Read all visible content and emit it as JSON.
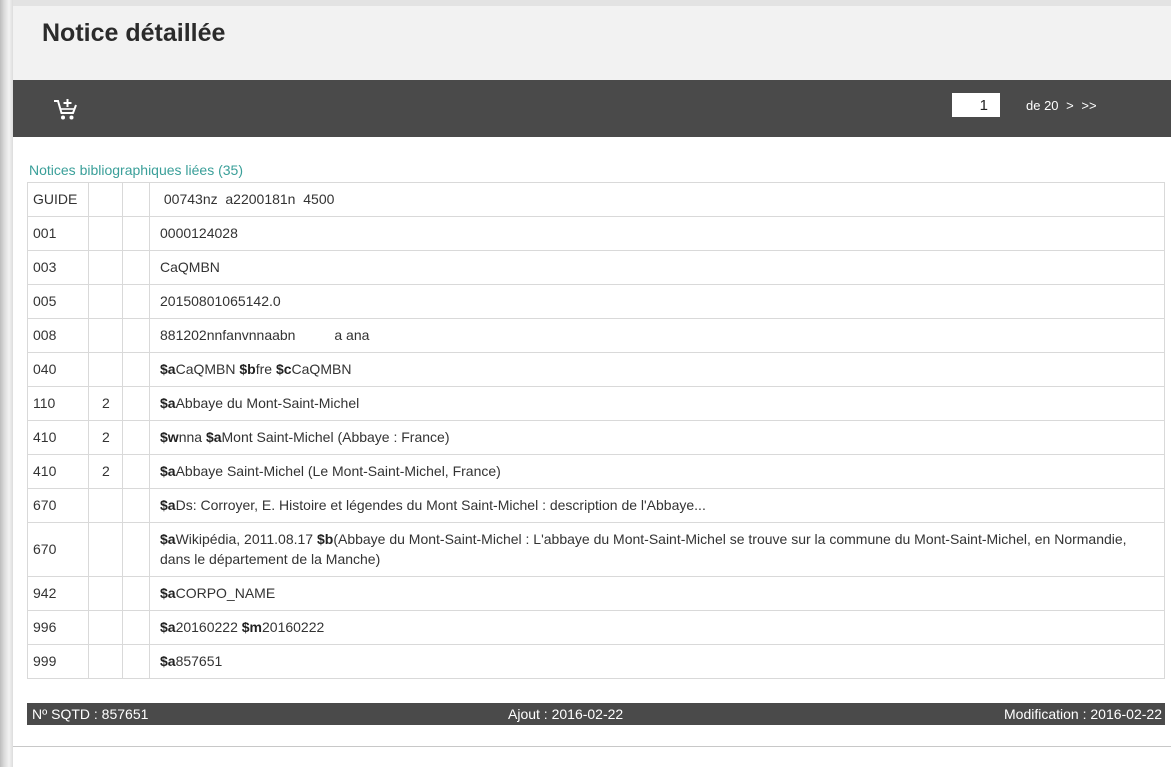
{
  "page": {
    "title": "Notice détaillée"
  },
  "toolbar": {
    "cart_icon": "add-to-cart-icon",
    "current_page": "1",
    "total_label": "de 20",
    "next_label": ">",
    "last_label": ">>",
    "background": "#4a4a4a"
  },
  "linked_records": {
    "label": "Notices bibliographiques liées (35)",
    "color": "#3a9f99"
  },
  "marc_fields": [
    {
      "tag": "GUIDE",
      "ind1": "",
      "ind2": "",
      "parts": [
        {
          "code": "",
          "text": " 00743nz  a2200181n  4500"
        }
      ]
    },
    {
      "tag": "001",
      "ind1": "",
      "ind2": "",
      "parts": [
        {
          "code": "",
          "text": "0000124028"
        }
      ]
    },
    {
      "tag": "003",
      "ind1": "",
      "ind2": "",
      "parts": [
        {
          "code": "",
          "text": "CaQMBN"
        }
      ]
    },
    {
      "tag": "005",
      "ind1": "",
      "ind2": "",
      "parts": [
        {
          "code": "",
          "text": "20150801065142.0"
        }
      ]
    },
    {
      "tag": "008",
      "ind1": "",
      "ind2": "",
      "parts": [
        {
          "code": "",
          "text": "881202nnfanvnnaabn          a ana"
        }
      ]
    },
    {
      "tag": "040",
      "ind1": "",
      "ind2": "",
      "parts": [
        {
          "code": "$a",
          "text": "CaQMBN "
        },
        {
          "code": "$b",
          "text": "fre "
        },
        {
          "code": "$c",
          "text": "CaQMBN"
        }
      ]
    },
    {
      "tag": "110",
      "ind1": "2",
      "ind2": "",
      "parts": [
        {
          "code": "$a",
          "text": "Abbaye du Mont-Saint-Michel"
        }
      ]
    },
    {
      "tag": "410",
      "ind1": "2",
      "ind2": "",
      "parts": [
        {
          "code": "$w",
          "text": "nna "
        },
        {
          "code": "$a",
          "text": "Mont Saint-Michel (Abbaye : France)"
        }
      ]
    },
    {
      "tag": "410",
      "ind1": "2",
      "ind2": "",
      "parts": [
        {
          "code": "$a",
          "text": "Abbaye Saint-Michel (Le Mont-Saint-Michel, France)"
        }
      ]
    },
    {
      "tag": "670",
      "ind1": "",
      "ind2": "",
      "parts": [
        {
          "code": "$a",
          "text": "Ds: Corroyer, E. Histoire et légendes du Mont Saint-Michel : description de l'Abbaye..."
        }
      ]
    },
    {
      "tag": "670",
      "ind1": "",
      "ind2": "",
      "parts": [
        {
          "code": "$a",
          "text": "Wikipédia, 2011.08.17 "
        },
        {
          "code": "$b",
          "text": "(Abbaye du Mont-Saint-Michel : L'abbaye du Mont-Saint-Michel se trouve sur la commune du Mont-Saint-Michel, en Normandie, dans le département de la Manche)"
        }
      ]
    },
    {
      "tag": "942",
      "ind1": "",
      "ind2": "",
      "parts": [
        {
          "code": "$a",
          "text": "CORPO_NAME"
        }
      ]
    },
    {
      "tag": "996",
      "ind1": "",
      "ind2": "",
      "parts": [
        {
          "code": "$a",
          "text": "20160222 "
        },
        {
          "code": "$m",
          "text": "20160222"
        }
      ]
    },
    {
      "tag": "999",
      "ind1": "",
      "ind2": "",
      "parts": [
        {
          "code": "$a",
          "text": "857651"
        }
      ]
    }
  ],
  "footer": {
    "sqtd": "Nº SQTD : 857651",
    "added": "Ajout : 2016-02-22",
    "modified": "Modification : 2016-02-22"
  }
}
